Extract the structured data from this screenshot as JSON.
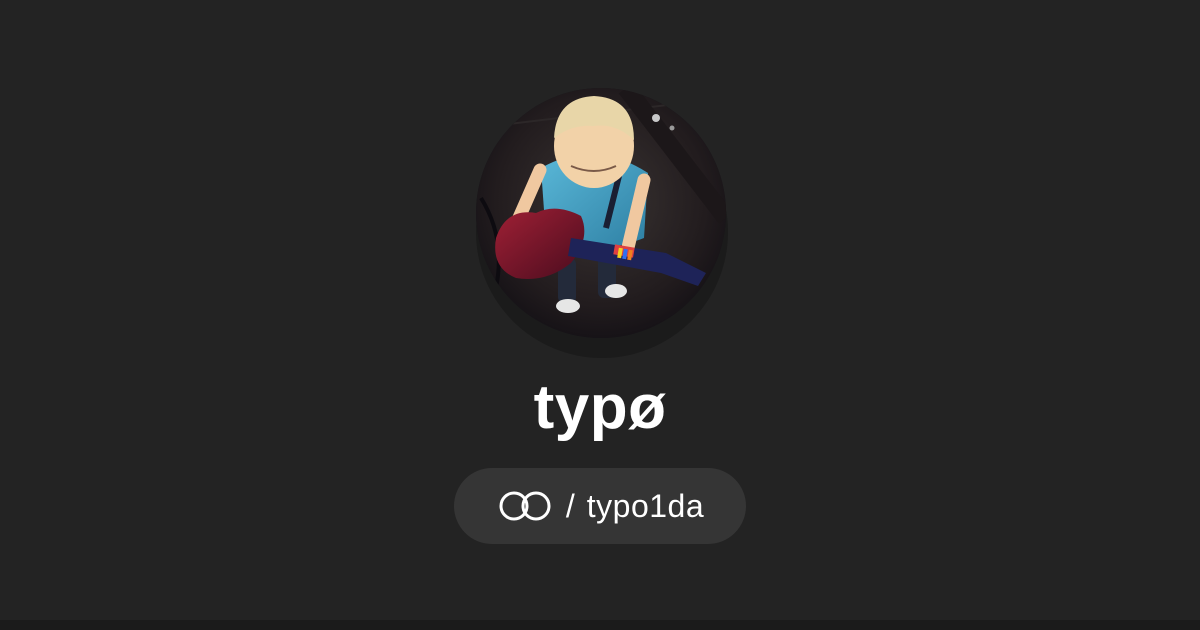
{
  "profile": {
    "display_name": "typø",
    "handle_separator": "/",
    "handle": "typo1da",
    "avatar_icon": "avatar-photo",
    "logo_icon": "linked-rings-icon"
  },
  "colors": {
    "background": "#232323",
    "pill": "#353535",
    "text": "#ffffff"
  }
}
